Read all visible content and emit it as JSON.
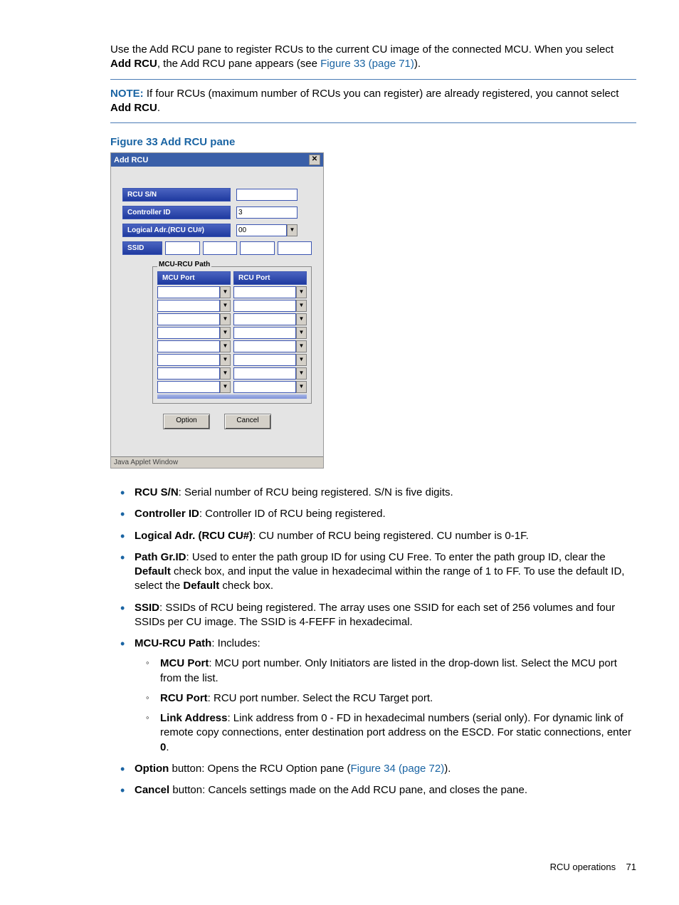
{
  "intro": {
    "p1a": "Use the Add RCU pane to register RCUs to the current CU image of the connected MCU. When you select ",
    "p1b": "Add RCU",
    "p1c": ", the Add RCU pane appears (see ",
    "p1link": "Figure 33 (page 71)",
    "p1d": ")."
  },
  "note": {
    "label": "NOTE:",
    "t1": " If four RCUs (maximum number of RCUs you can register) are already registered, you cannot select ",
    "t2": "Add RCU",
    "t3": "."
  },
  "figure_caption": "Figure 33 Add RCU pane",
  "dialog": {
    "title": "Add RCU",
    "close": "✕",
    "labels": {
      "rcu_sn": "RCU S/N",
      "controller_id": "Controller ID",
      "logical_adr": "Logical Adr.(RCU CU#)",
      "ssid": "SSID",
      "fieldset": "MCU-RCU Path",
      "mcu_port": "MCU Port",
      "rcu_port": "RCU Port"
    },
    "values": {
      "rcu_sn": "",
      "controller_id": "3",
      "logical_adr": "00"
    },
    "buttons": {
      "option": "Option",
      "cancel": "Cancel"
    },
    "status": "Java Applet Window"
  },
  "bullets": {
    "b1": {
      "t1": "RCU S/N",
      "t2": ": Serial number of RCU being registered. S/N is five digits."
    },
    "b2": {
      "t1": "Controller ID",
      "t2": ": Controller ID of RCU being registered."
    },
    "b3": {
      "t1": "Logical Adr. (RCU CU#)",
      "t2": ": CU number of RCU being registered. CU number is 0-1F."
    },
    "b4": {
      "t1": "Path Gr.ID",
      "t2": ": Used to enter the path group ID for using CU Free. To enter the path group ID, clear the ",
      "t3": "Default",
      "t4": " check box, and input the value in hexadecimal within the range of 1 to FF. To use the default ID, select the ",
      "t5": "Default",
      "t6": " check box."
    },
    "b5": {
      "t1": "SSID",
      "t2": ": SSIDs of RCU being registered. The array uses one SSID for each set of 256 volumes and four SSIDs per CU image. The SSID is 4-FEFF in hexadecimal."
    },
    "b6": {
      "t1": "MCU-RCU Path",
      "t2": ": Includes:"
    },
    "s1": {
      "t1": "MCU Port",
      "t2": ": MCU port number. Only Initiators are listed in the drop-down list. Select the MCU port from the list."
    },
    "s2": {
      "t1": "RCU Port",
      "t2": ": RCU port number. Select the RCU Target port."
    },
    "s3": {
      "t1": "Link Address",
      "t2": ": Link address from 0 - FD in hexadecimal numbers (serial only). For dynamic link of remote copy connections, enter destination port address on the ESCD. For static connections, enter ",
      "t3": "0",
      "t4": "."
    },
    "b7": {
      "t1": "Option",
      "t2": " button: Opens the RCU Option pane (",
      "link": "Figure 34 (page 72)",
      "t3": ")."
    },
    "b8": {
      "t1": "Cancel",
      "t2": " button: Cancels settings made on the Add RCU pane, and closes the pane."
    }
  },
  "footer": {
    "section": "RCU operations",
    "page": "71"
  }
}
